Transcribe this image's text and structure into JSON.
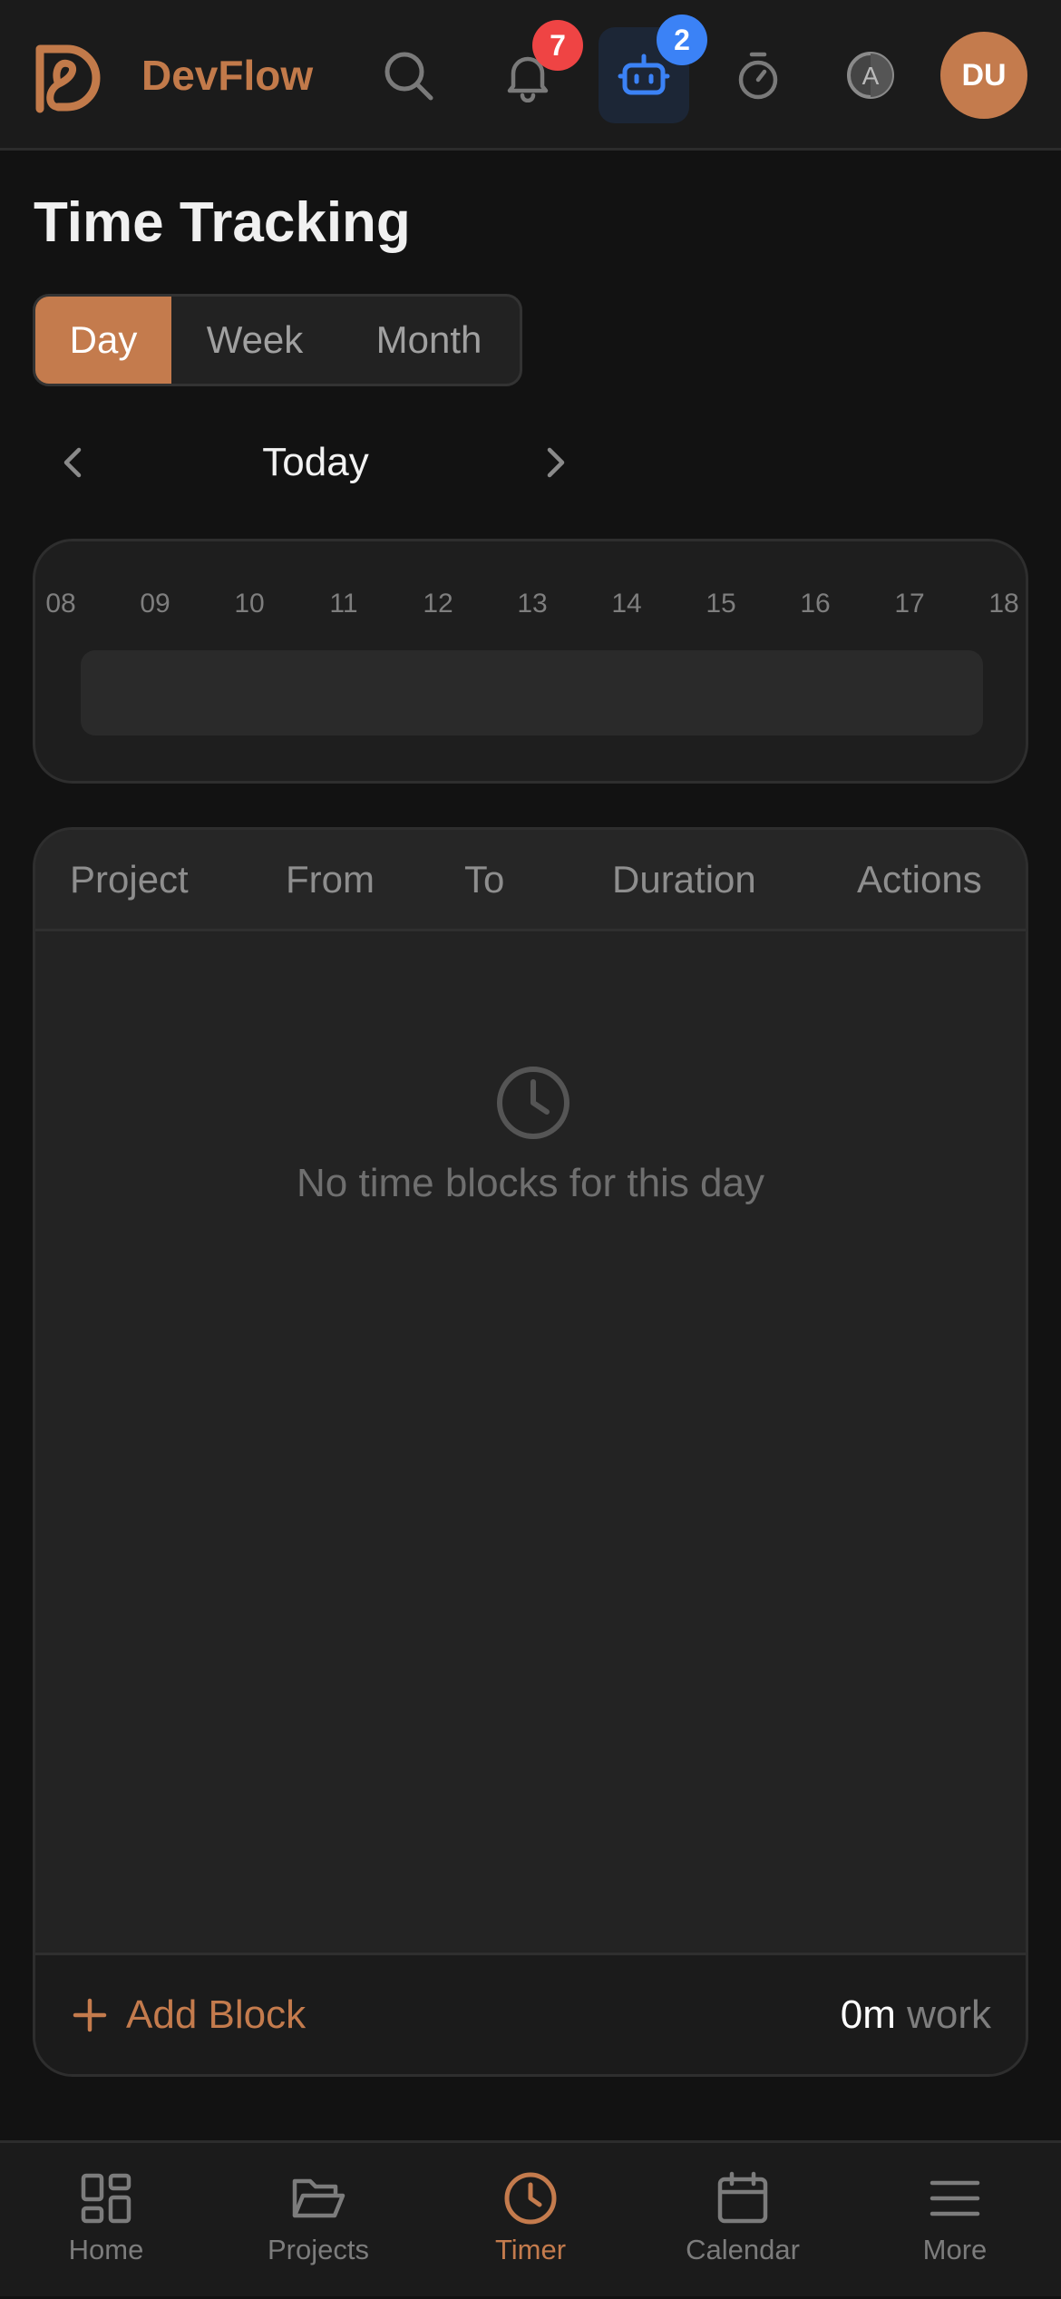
{
  "header": {
    "brand": "DevFlow",
    "notifications_badge": "7",
    "assistant_badge": "2",
    "avatar_initials": "DU",
    "icons": [
      "devflow-logo",
      "search-icon",
      "bell-icon",
      "robot-icon",
      "stopwatch-icon",
      "auto-theme-icon"
    ]
  },
  "page": {
    "title": "Time Tracking"
  },
  "range_tabs": [
    {
      "label": "Day",
      "active": true
    },
    {
      "label": "Week",
      "active": false
    },
    {
      "label": "Month",
      "active": false
    }
  ],
  "date_nav": {
    "label": "Today",
    "prev_icon": "chevron-left-icon",
    "next_icon": "chevron-right-icon"
  },
  "timeline": {
    "hours": [
      "08",
      "09",
      "10",
      "11",
      "12",
      "13",
      "14",
      "15",
      "16",
      "17",
      "18"
    ]
  },
  "table": {
    "columns": [
      "Project",
      "From",
      "To",
      "Duration",
      "Actions"
    ],
    "rows": [],
    "empty_text": "No time blocks for this day",
    "empty_icon": "clock-icon"
  },
  "footer": {
    "add_label": "Add Block",
    "total_value": "0m",
    "total_unit": "work"
  },
  "nav": [
    {
      "label": "Home",
      "icon": "grid-icon",
      "active": false
    },
    {
      "label": "Projects",
      "icon": "folder-icon",
      "active": false
    },
    {
      "label": "Timer",
      "icon": "clock-icon",
      "active": true
    },
    {
      "label": "Calendar",
      "icon": "calendar-icon",
      "active": false
    },
    {
      "label": "More",
      "icon": "menu-icon",
      "active": false
    }
  ],
  "colors": {
    "accent": "#c47b4d",
    "background": "#121212",
    "badge_red": "#ef4444",
    "badge_blue": "#3b82f6"
  }
}
